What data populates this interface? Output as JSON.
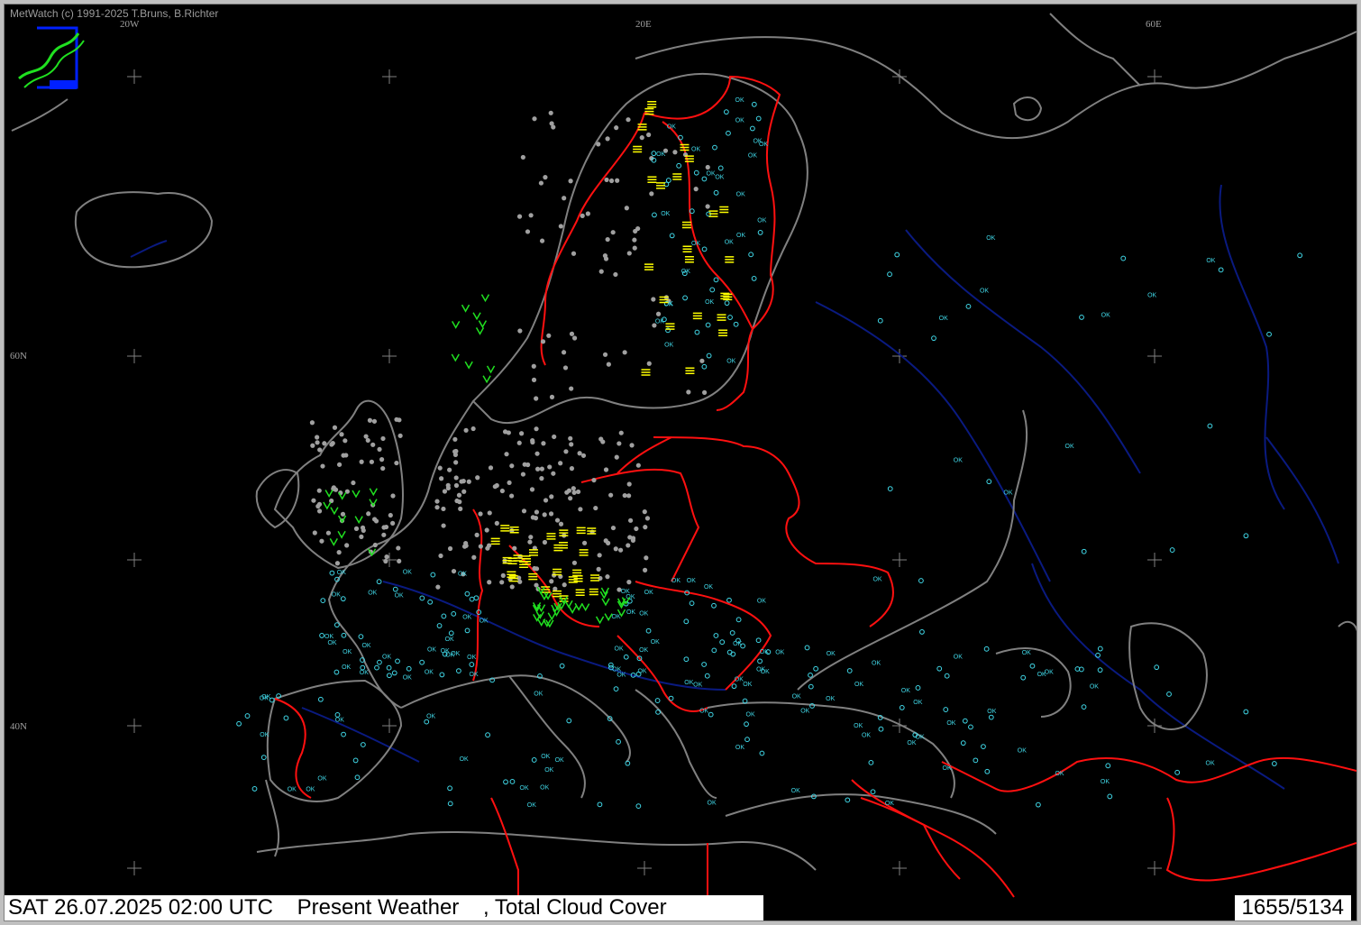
{
  "credit": "MetWatch  (c) 1991-2025 T.Bruns, B.Richter",
  "grid_labels": {
    "lon_20w": "20W",
    "lon_20e": "20E",
    "lon_60e": "60E",
    "lat_60n": "60N",
    "lat_40n": "40N"
  },
  "status": {
    "datetime": "SAT 26.07.2025 02:00 UTC",
    "product": "Present Weather",
    "separator": ",",
    "product2": "Total Cloud Cover",
    "count": "1655/5134"
  },
  "colors": {
    "background": "#000000",
    "coastline": "#808080",
    "borders": "#ff1010",
    "rivers": "#0a1a80",
    "obs_clear": "#40d8e8",
    "obs_cloudy": "#a0a0a0",
    "obs_fog": "#ffff00",
    "obs_rain": "#20e020",
    "logo": "#0020ff"
  },
  "map": {
    "region": "Europe",
    "legend_symbol_ok": "OK"
  }
}
